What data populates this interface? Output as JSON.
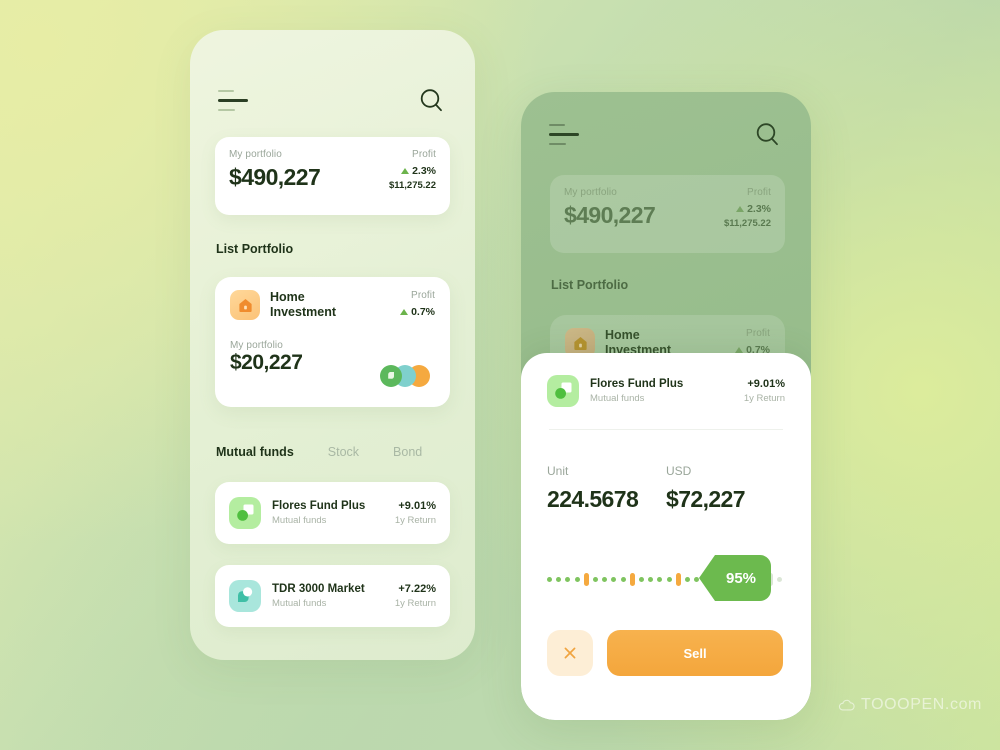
{
  "app": {
    "icons": {
      "menu": "hamburger-menu-icon",
      "search": "search-icon",
      "home": "home-icon",
      "close": "close-icon",
      "cloud": "cloud-icon"
    },
    "colors": {
      "accent_green": "#6cba4e",
      "accent_orange": "#f4a63c",
      "text_dark": "#1f3319",
      "text_muted": "#9aa69a",
      "profit_green": "#6cb34c",
      "teal": "#7fd0cd"
    }
  },
  "phone1": {
    "portfolio_card": {
      "label": "My portfolio",
      "amount": "$490,227",
      "profit_label": "Profit",
      "profit_pct": "2.3%",
      "profit_amount": "$11,275.22"
    },
    "list_portfolio_title": "List Portfolio",
    "home_investment": {
      "name_line1": "Home",
      "name_line2": "Investment",
      "profit_label": "Profit",
      "profit_pct": "0.7%",
      "portfolio_label": "My portfolio",
      "amount": "$20,227"
    },
    "tabs": [
      {
        "label": "Mutual funds",
        "active": true
      },
      {
        "label": "Stock",
        "active": false
      },
      {
        "label": "Bond",
        "active": false
      }
    ],
    "funds": [
      {
        "name": "Flores Fund Plus",
        "category": "Mutual funds",
        "percent": "+9.01%",
        "return_label": "1y Return"
      },
      {
        "name": "TDR 3000 Market",
        "category": "Mutual funds",
        "percent": "+7.22%",
        "return_label": "1y Return"
      }
    ]
  },
  "phone2": {
    "background": {
      "portfolio_card": {
        "label": "My portfolio",
        "amount": "$490,227",
        "profit_label": "Profit",
        "profit_pct": "2.3%",
        "profit_amount": "$11,275.22"
      },
      "list_portfolio_title": "List Portfolio",
      "home_investment": {
        "name_line1": "Home",
        "name_line2": "Investment",
        "profit_label": "Profit",
        "profit_pct": "0.7%"
      }
    },
    "sheet": {
      "fund": {
        "name": "Flores Fund Plus",
        "category": "Mutual funds",
        "percent": "+9.01%",
        "return_label": "1y Return"
      },
      "unit_label": "Unit",
      "unit_value": "224.5678",
      "usd_label": "USD",
      "usd_value": "$72,227",
      "slider_percent": "95%",
      "slider_value": 95,
      "close_label": "×",
      "sell_label": "Sell"
    }
  },
  "watermark": {
    "text": "TOOOPEN.com"
  }
}
